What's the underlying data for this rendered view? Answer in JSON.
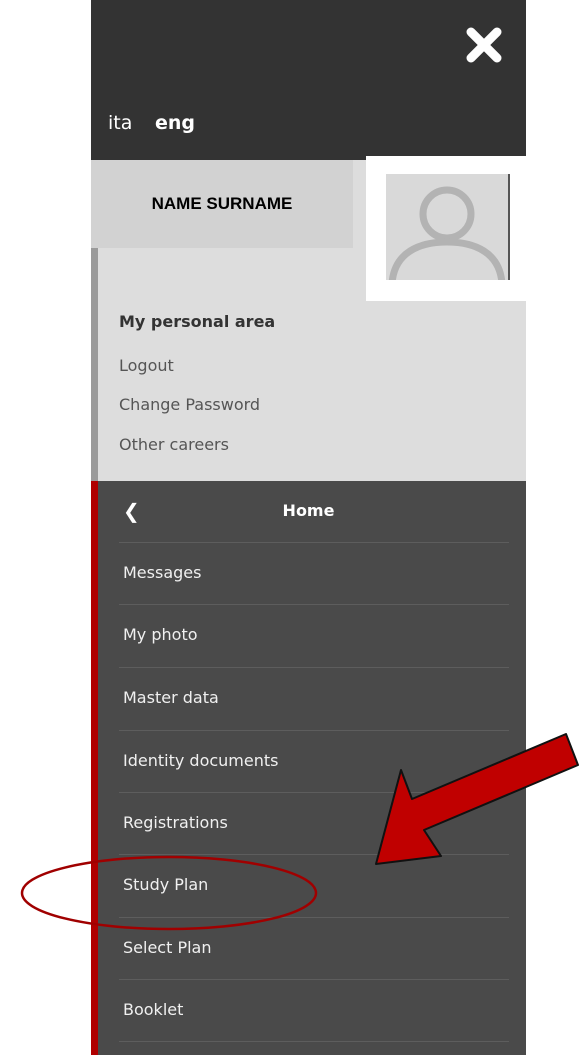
{
  "languages": {
    "ita": "ita",
    "eng": "eng"
  },
  "profile": {
    "name": "NAME SURNAME"
  },
  "personal_area": {
    "title": "My personal area",
    "links": [
      "Logout",
      "Change Password",
      "Other careers"
    ]
  },
  "menu": {
    "back_icon": "chevron-left-icon",
    "home_label": "Home",
    "items": [
      "Messages",
      "My photo",
      "Master data",
      "Identity documents",
      "Registrations",
      "Study Plan",
      "Select Plan",
      "Booklet"
    ]
  },
  "colors": {
    "topbar": "#333333",
    "menu_bg": "#4a4a4a",
    "accent_stripe": "#b00000",
    "annotation": "#b00000"
  }
}
